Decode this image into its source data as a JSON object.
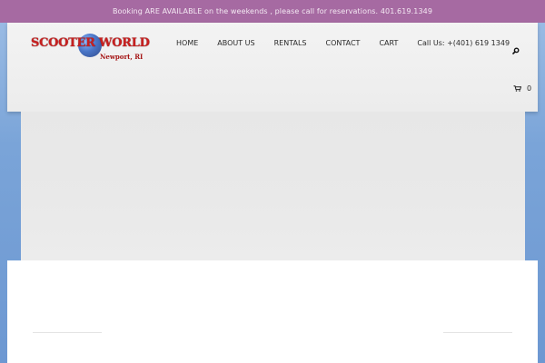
{
  "announcement": {
    "text": "Booking ARE AVAILABLE on the weekends , please call for reservations. 401.619.1349"
  },
  "logo": {
    "title": "SCOOTER WORLD",
    "subtitle": "Newport, RI"
  },
  "nav": {
    "items": [
      {
        "label": "HOME"
      },
      {
        "label": "ABOUT US"
      },
      {
        "label": "RENTALS"
      },
      {
        "label": "CONTACT"
      },
      {
        "label": "CART"
      }
    ],
    "phone": "Call Us: +(401) 619 1349"
  },
  "cart": {
    "count": "0"
  },
  "icons": {
    "search": "search-icon",
    "cart": "cart-icon"
  },
  "colors": {
    "topbar": "#a66aa2",
    "logo_red": "#c81f1f",
    "background_blue": "#7aa4d8"
  }
}
